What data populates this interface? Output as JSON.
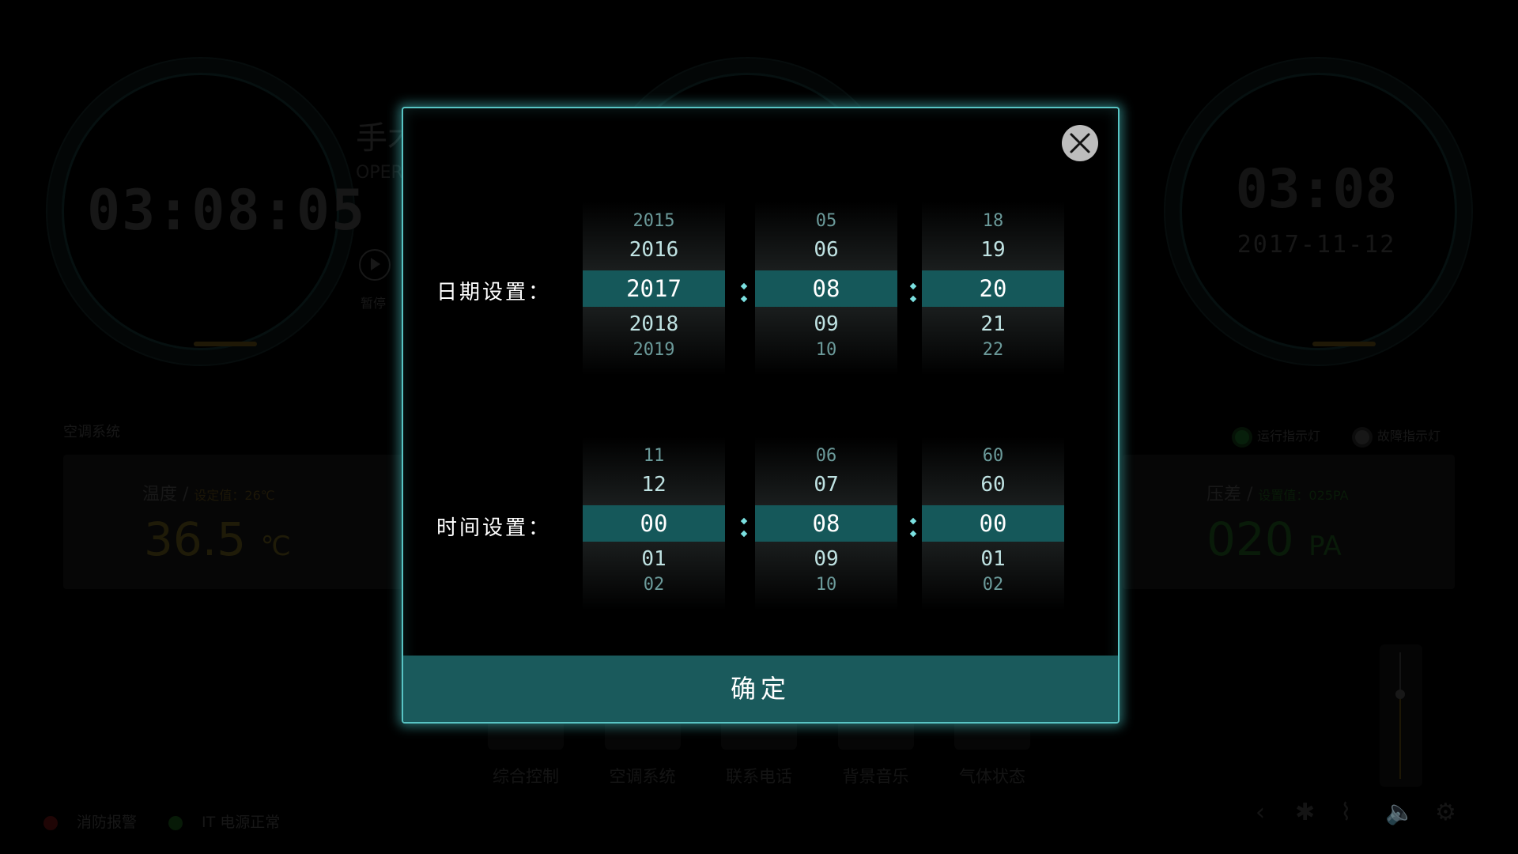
{
  "background": {
    "left_clock": "03:08:05",
    "mode_title": "手术",
    "mode_subtitle": "OPER",
    "pause_label": "暂停",
    "right_clock": {
      "time": "03:08",
      "date": "2017-11-12"
    },
    "section_title": "空调系统",
    "temperature": {
      "label": "温度 /",
      "setpoint": "设定值：26℃",
      "value": "36.5",
      "unit": "℃"
    },
    "pressure": {
      "label": "压差 /",
      "setpoint": "设置值：025PA",
      "value": "020",
      "unit": "PA"
    },
    "indicators": {
      "run": "运行指示灯",
      "fault": "故障指示灯"
    },
    "nav": [
      "综合控制",
      "空调系统",
      "联系电话",
      "背景音乐",
      "气体状态"
    ],
    "alarms": {
      "fire": "消防报警",
      "power": "IT 电源正常"
    },
    "volume_level": 0.67,
    "tray_icons": [
      "back-icon",
      "bluetooth-icon",
      "wifi-icon",
      "volume-icon",
      "settings-icon"
    ],
    "tray_glyphs": [
      "‹",
      "✱",
      "⌇",
      "🔈",
      "⚙"
    ]
  },
  "modal": {
    "date_label": "日期设置：",
    "time_label": "时间设置：",
    "date_pickers": [
      {
        "items": [
          "2015",
          "2016",
          "2017",
          "2018",
          "2019"
        ]
      },
      {
        "items": [
          "05",
          "06",
          "08",
          "09",
          "10"
        ]
      },
      {
        "items": [
          "18",
          "19",
          "20",
          "21",
          "22"
        ]
      }
    ],
    "time_pickers": [
      {
        "items": [
          "11",
          "12",
          "00",
          "01",
          "02"
        ]
      },
      {
        "items": [
          "06",
          "07",
          "08",
          "09",
          "10"
        ]
      },
      {
        "items": [
          "60",
          "60",
          "00",
          "01",
          "02"
        ]
      }
    ],
    "confirm_label": "确定"
  },
  "colors": {
    "accent": "#58c4c4",
    "selected_row": "#15585a",
    "confirm_bg": "#1a5a5c"
  }
}
